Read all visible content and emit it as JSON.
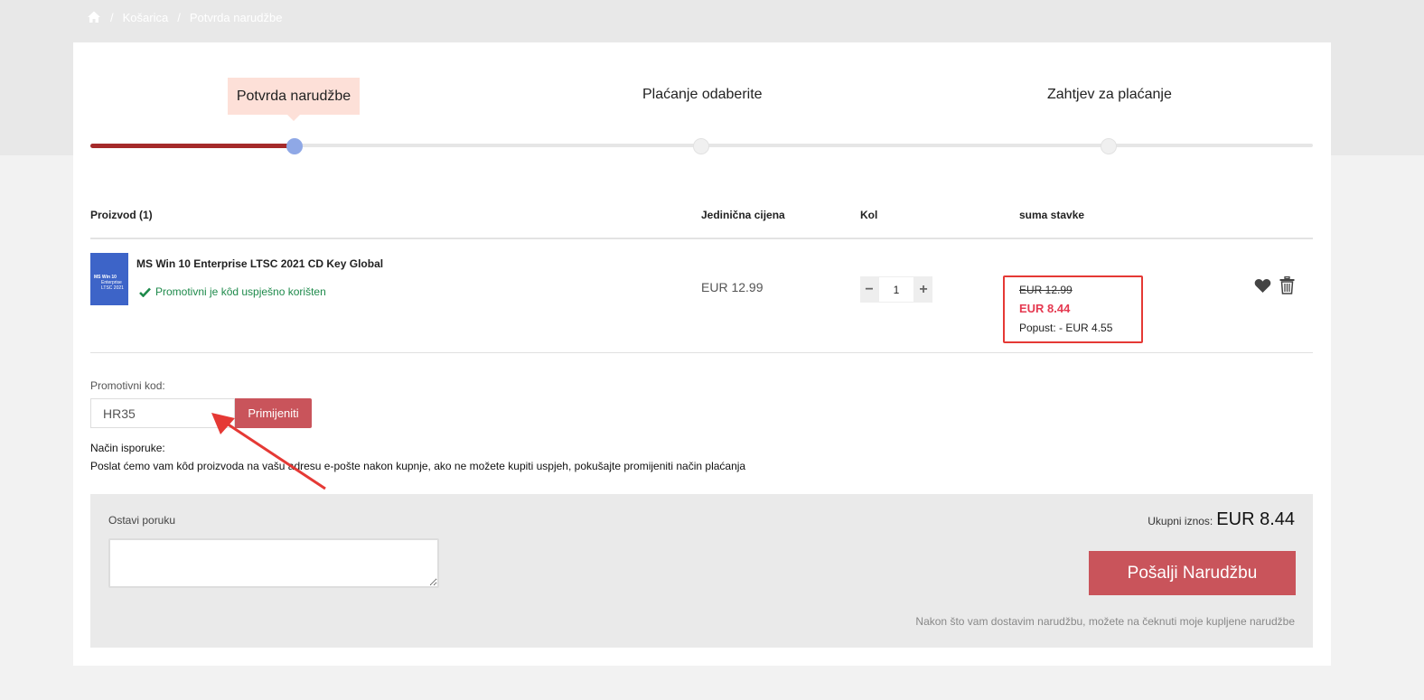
{
  "breadcrumb": {
    "home_icon": "home-icon",
    "items": [
      "Košarica",
      "Potvrda narudžbe"
    ],
    "separator": "/"
  },
  "steps": [
    {
      "label": "Potvrda narudžbe",
      "active": true
    },
    {
      "label": "Plaćanje odaberite",
      "active": false
    },
    {
      "label": "Zahtjev za plaćanje",
      "active": false
    }
  ],
  "progress": {
    "completed_steps": 1,
    "total_steps": 3
  },
  "table": {
    "headers": {
      "product": "Proizvod (1)",
      "unit_price": "Jedinična cijena",
      "qty": "Kol",
      "sum": "suma stavke"
    },
    "row": {
      "image_text": "MS Win 10",
      "image_subtext": "Enterprise LTSC 2021",
      "name": "MS Win 10 Enterprise LTSC 2021 CD Key Global",
      "promo_status": "Promotivni je kôd uspješno korišten",
      "unit_price": "EUR 12.99",
      "qty": "1",
      "qty_minus": "−",
      "qty_plus": "+",
      "old_price": "EUR 12.99",
      "new_price": "EUR 8.44",
      "discount": "Popust: - EUR 4.55"
    }
  },
  "promo": {
    "label": "Promotivni kod:",
    "value": "HR35",
    "apply_label": "Primijeniti"
  },
  "delivery": {
    "title": "Način isporuke:",
    "text": "Poslat ćemo vam kôd proizvoda na vašu adresu e-pošte nakon kupnje, ako ne možete kupiti uspjeh, pokušajte promijeniti način plaćanja"
  },
  "order": {
    "message_label": "Ostavi poruku",
    "message_value": "",
    "total_label": "Ukupni iznos:",
    "total_amount": "EUR 8.44",
    "submit_label": "Pošalji Narudžbu",
    "note": "Nakon što vam dostavim narudžbu, možete na čeknuti moje kupljene narudžbe"
  },
  "colors": {
    "accent": "#c9545b",
    "progress": "#a52a2a",
    "step_active_bg": "#fde0d8",
    "active_dot": "#8fa8e6",
    "success": "#1e8a4b",
    "highlight": "#e53935"
  }
}
